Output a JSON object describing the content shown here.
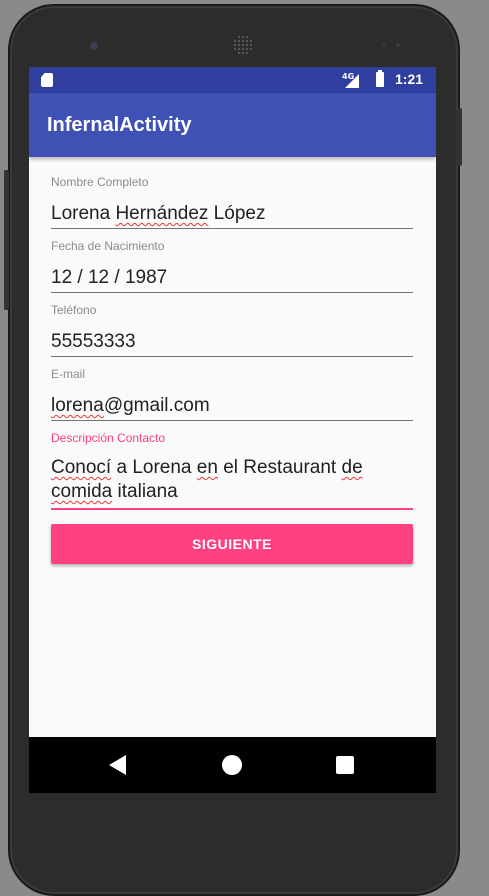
{
  "status_bar": {
    "network": "4G",
    "time": "1:21"
  },
  "app_bar": {
    "title": "InfernalActivity"
  },
  "form": {
    "nombre": {
      "label": "Nombre Completo",
      "value_parts": [
        "Lorena ",
        "Hernández",
        " López"
      ]
    },
    "fecha": {
      "label": "Fecha de Nacimiento",
      "value": "12 / 12 / 1987"
    },
    "telefono": {
      "label": "Teléfono",
      "value": "55553333"
    },
    "email": {
      "label": "E-mail",
      "value_parts": [
        "lorena",
        "@gmail.com"
      ]
    },
    "descripcion": {
      "label": "Descripción Contacto",
      "value_parts": [
        "Conocí",
        " a Lorena ",
        "en",
        " el Restaurant ",
        "de",
        "comida",
        " italiana"
      ]
    }
  },
  "button": {
    "label": "SIGUIENTE"
  },
  "colors": {
    "primary": "#3f51b5",
    "primary_dark": "#303f9f",
    "accent": "#ff4081"
  }
}
